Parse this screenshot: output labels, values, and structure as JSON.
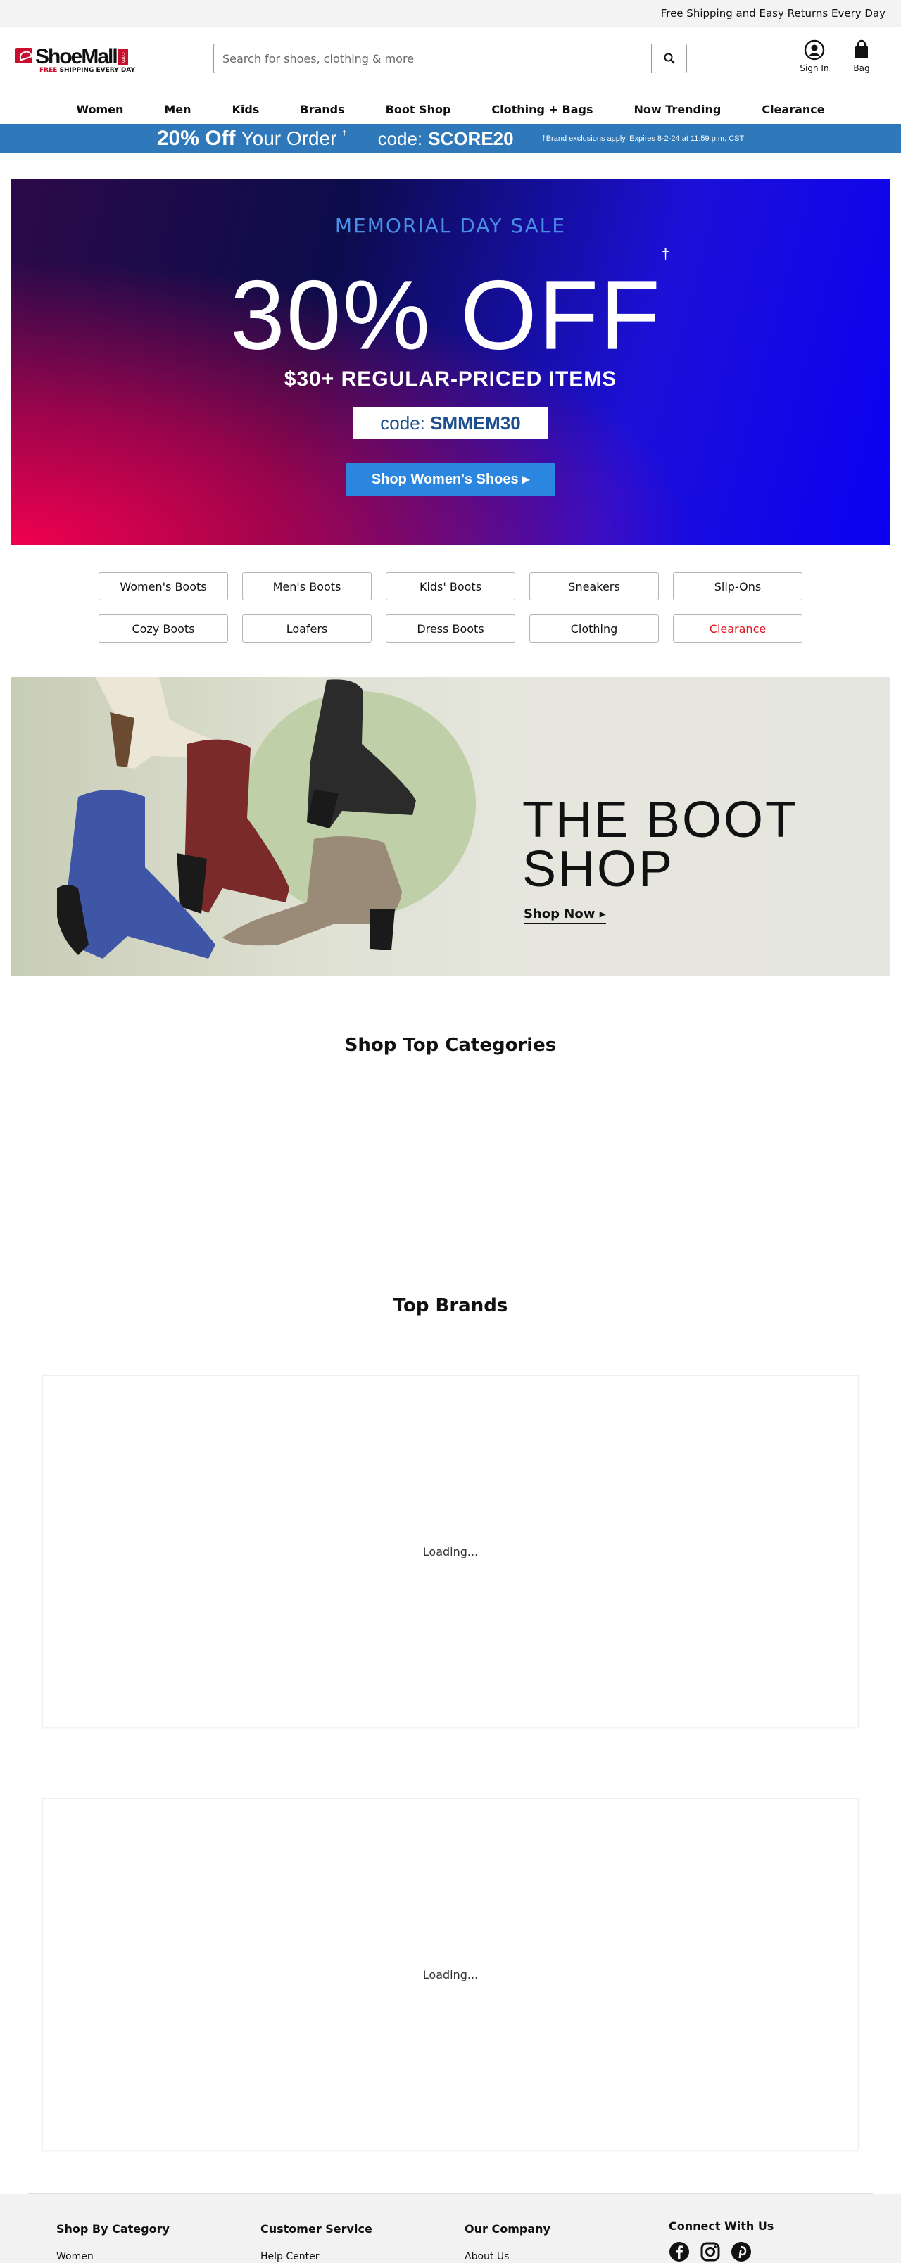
{
  "topbar": {
    "text": "Free Shipping and Easy Returns Every Day"
  },
  "logo": {
    "name": "ShoeMall",
    "dotcom": ".com",
    "tag_red": "FREE",
    "tag_rest": " SHIPPING EVERY DAY"
  },
  "search": {
    "placeholder": "Search for shoes, clothing & more"
  },
  "header": {
    "sign_in": "Sign In",
    "bag": "Bag"
  },
  "nav": [
    "Women",
    "Men",
    "Kids",
    "Brands",
    "Boot Shop",
    "Clothing + Bags",
    "Now Trending",
    "Clearance"
  ],
  "promo": {
    "bold": "20% Off",
    "rest": "Your Order",
    "dagger": "†",
    "code_label": "code:",
    "code": "SCORE20",
    "fine": "†Brand exclusions apply. Expires 8-2-24 at 11:59 p.m. CST"
  },
  "hero": {
    "eyebrow": "MEMORIAL DAY SALE",
    "headline": "30% OFF",
    "dagger": "†",
    "sub": "$30+ REGULAR-PRICED ITEMS",
    "code_label": "code:",
    "code": "SMMEM30",
    "cta": "Shop Women's Shoes ▸"
  },
  "categories": [
    "Women's Boots",
    "Men's Boots",
    "Kids' Boots",
    "Sneakers",
    "Slip-Ons",
    "Cozy Boots",
    "Loafers",
    "Dress Boots",
    "Clothing",
    "Clearance"
  ],
  "boot_shop": {
    "line1": "THE BOOT",
    "line2": "SHOP",
    "cta": "Shop Now ▸"
  },
  "sections": {
    "top_categories": "Shop Top Categories",
    "top_brands": "Top Brands",
    "loading": "Loading..."
  },
  "footer": {
    "cols": [
      {
        "heading": "Shop By Category",
        "first": "Women"
      },
      {
        "heading": "Customer Service",
        "first": "Help Center"
      },
      {
        "heading": "Our Company",
        "first": "About Us"
      },
      {
        "heading": "Connect With Us",
        "first": ""
      }
    ],
    "social": [
      "facebook-icon",
      "instagram-icon",
      "pinterest-icon"
    ]
  },
  "colors": {
    "promo_bar": "#2f78b9",
    "brand_red": "#c8102e",
    "clearance_red": "#e2131e",
    "cta_blue": "#2a86de"
  }
}
